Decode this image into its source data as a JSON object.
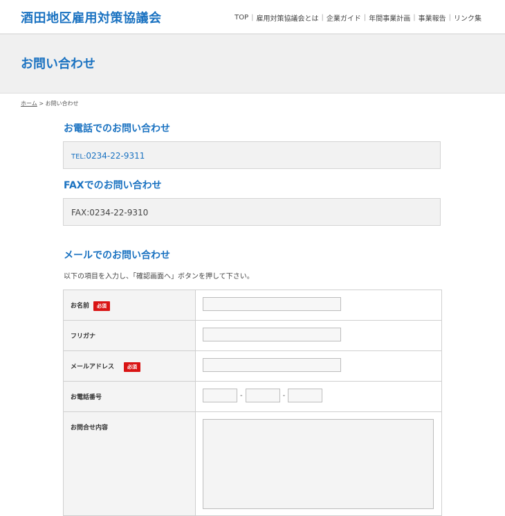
{
  "header": {
    "site_title": "酒田地区雇用対策協議会",
    "nav": [
      "TOP",
      "雇用対策協議会とは",
      "企業ガイド",
      "年間事業計画",
      "事業報告",
      "リンク集"
    ]
  },
  "page": {
    "title": "お問い合わせ"
  },
  "breadcrumb": {
    "home": "ホーム",
    "separator": ">",
    "current": "お問い合わせ"
  },
  "phone": {
    "heading": "お電話でのお問い合わせ",
    "label": "TEL:",
    "number": "0234-22-9311"
  },
  "fax": {
    "heading": "FAXでのお問い合わせ",
    "text": "FAX:0234-22-9310"
  },
  "mail": {
    "heading": "メールでのお問い合わせ",
    "intro": "以下の項目を入力し、「確認画面へ」ボタンを押して下さい。",
    "required_badge": "必須",
    "fields": {
      "name": "お名前",
      "kana": "フリガナ",
      "email": "メールアドレス",
      "tel": "お電話番号",
      "message": "お問合せ内容"
    },
    "tel_separator": "-"
  },
  "colors": {
    "accent": "#1a72c1",
    "required": "#d91414",
    "panel": "#f0f0f0"
  }
}
